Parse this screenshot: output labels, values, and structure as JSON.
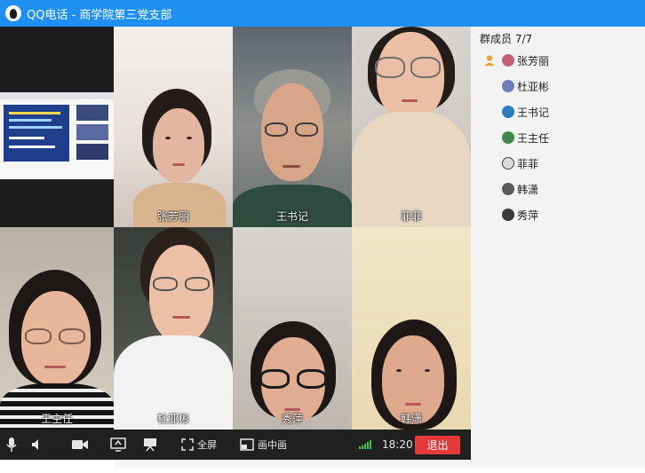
{
  "window": {
    "title": "QQ电话 - 商学院第三党支部",
    "accent": "#1f8ff2"
  },
  "members_panel": {
    "header": "群成员 7/7",
    "members": [
      {
        "name": "张芳丽",
        "host": true
      },
      {
        "name": "杜亚彬"
      },
      {
        "name": "王书记"
      },
      {
        "name": "王主任"
      },
      {
        "name": "菲菲"
      },
      {
        "name": "韩潇"
      },
      {
        "name": "秀萍"
      }
    ]
  },
  "video_tiles": [
    {
      "name": ""
    },
    {
      "name": "张芳丽"
    },
    {
      "name": "王书记"
    },
    {
      "name": "菲菲"
    },
    {
      "name": "王主任"
    },
    {
      "name": "杜亚彬"
    },
    {
      "name": "秀萍"
    },
    {
      "name": "韩潇"
    }
  ],
  "toolbar": {
    "fullscreen_label": "全屏",
    "pip_label": "画中画",
    "time": "18:20",
    "exit_label": "退出",
    "exit_color": "#e4383a",
    "signal_color": "#35c24a"
  }
}
